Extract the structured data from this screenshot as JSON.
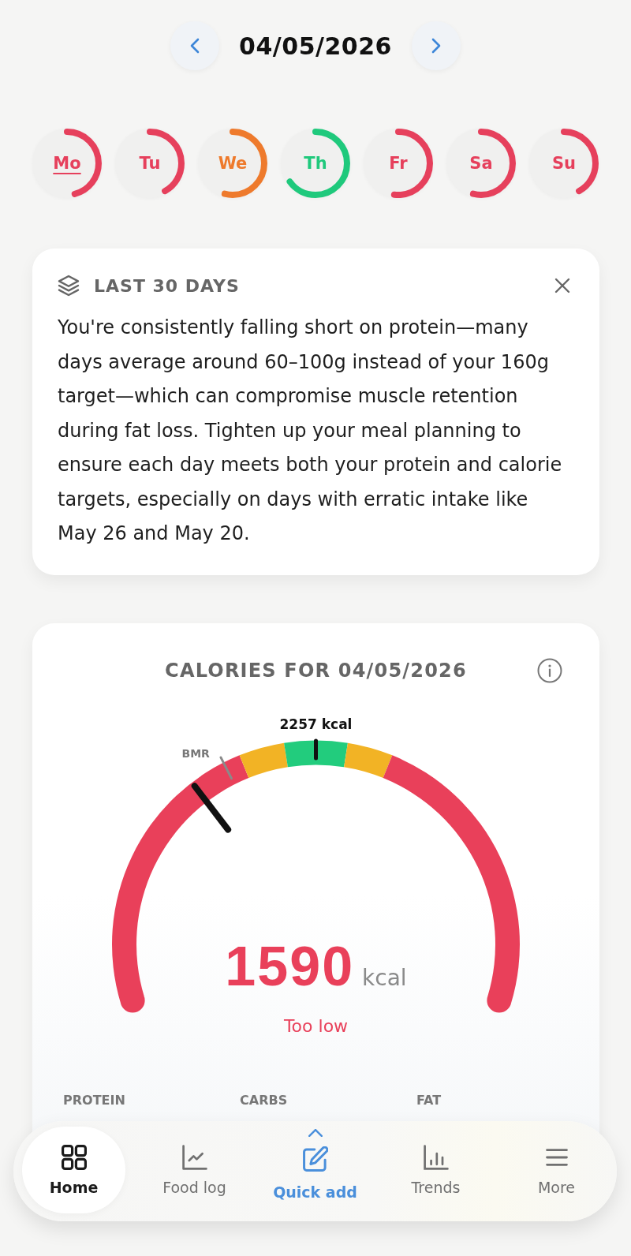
{
  "header": {
    "date": "04/05/2026"
  },
  "days": [
    {
      "label": "Mo",
      "selected": true,
      "level": 0.46,
      "color": "#e6405c"
    },
    {
      "label": "Tu",
      "selected": false,
      "level": 0.42,
      "color": "#e6405c"
    },
    {
      "label": "We",
      "selected": false,
      "level": 0.54,
      "color": "#ee7a2c"
    },
    {
      "label": "Th",
      "selected": false,
      "level": 0.65,
      "color": "#1fc97c"
    },
    {
      "label": "Fr",
      "selected": false,
      "level": 0.52,
      "color": "#e6405c"
    },
    {
      "label": "Sa",
      "selected": false,
      "level": 0.54,
      "color": "#e6405c"
    },
    {
      "label": "Su",
      "selected": false,
      "level": 0.42,
      "color": "#e6405c"
    }
  ],
  "insight": {
    "title": "LAST 30 DAYS",
    "body": "You're consistently falling short on protein—many days average around 60–100g instead of your 160g target—which can compromise muscle retention during fat loss. Tighten up your meal planning to ensure each day meets both your protein and calorie targets, especially on days with erratic intake like May 26 and May 20."
  },
  "calories": {
    "title": "CALORIES FOR 04/05/2026",
    "gauge": {
      "zones": [
        {
          "color": "#e9405a"
        },
        {
          "color": "#f2b325"
        },
        {
          "color": "#22cc7d"
        },
        {
          "color": "#f2b325"
        },
        {
          "color": "#e9405a"
        }
      ],
      "target": {
        "label": "2257 kcal",
        "level": 0.5
      },
      "bmr": {
        "label": "BMR",
        "level": 0.374
      },
      "level": 0.325,
      "value": "1590",
      "unit": "kcal",
      "status": "Too low"
    },
    "macros": [
      "PROTEIN",
      "CARBS",
      "FAT"
    ]
  },
  "nav": [
    {
      "label": "Home",
      "kind": "tab",
      "selected": true
    },
    {
      "label": "Food log",
      "kind": "tab",
      "selected": false
    },
    {
      "label": "Quick add",
      "kind": "action",
      "selected": false
    },
    {
      "label": "Trends",
      "kind": "tab",
      "selected": false
    },
    {
      "label": "More",
      "kind": "tab",
      "selected": false
    }
  ]
}
